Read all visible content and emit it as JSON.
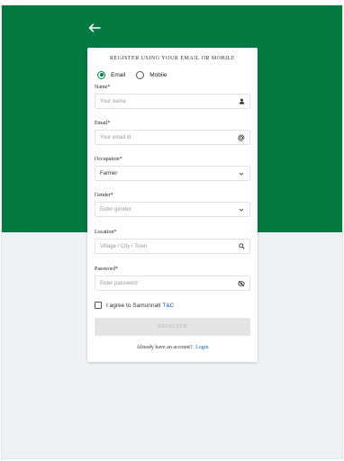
{
  "form": {
    "title": "REGISTER USING YOUR EMAIL OR MOBILE",
    "options": {
      "email": "Email",
      "mobile": "Mobile",
      "selected": "email"
    },
    "name": {
      "label": "Name*",
      "placeholder": "Your name",
      "icon": "person-icon"
    },
    "email": {
      "label": "Email*",
      "placeholder": "Your email id",
      "icon": "at-icon"
    },
    "occupation": {
      "label": "Occupation*",
      "value": "Farmer",
      "icon": "chevron-down-icon"
    },
    "gender": {
      "label": "Gender*",
      "placeholder": "Enter gender",
      "icon": "chevron-down-icon"
    },
    "location": {
      "label": "Location*",
      "placeholder": "Village / City / Town",
      "icon": "search-icon"
    },
    "password": {
      "label": "Password*",
      "placeholder": "Enter password",
      "icon": "eye-off-icon"
    },
    "terms": {
      "text": "I agree to Samunnati",
      "link": "T&C",
      "checked": false
    },
    "register_label": "REGISTER",
    "footer": {
      "text": "Already have an account?",
      "link": "Login"
    }
  },
  "colors": {
    "brand": "#037a42",
    "link": "#1a5fb4",
    "background": "#eef2f6"
  }
}
